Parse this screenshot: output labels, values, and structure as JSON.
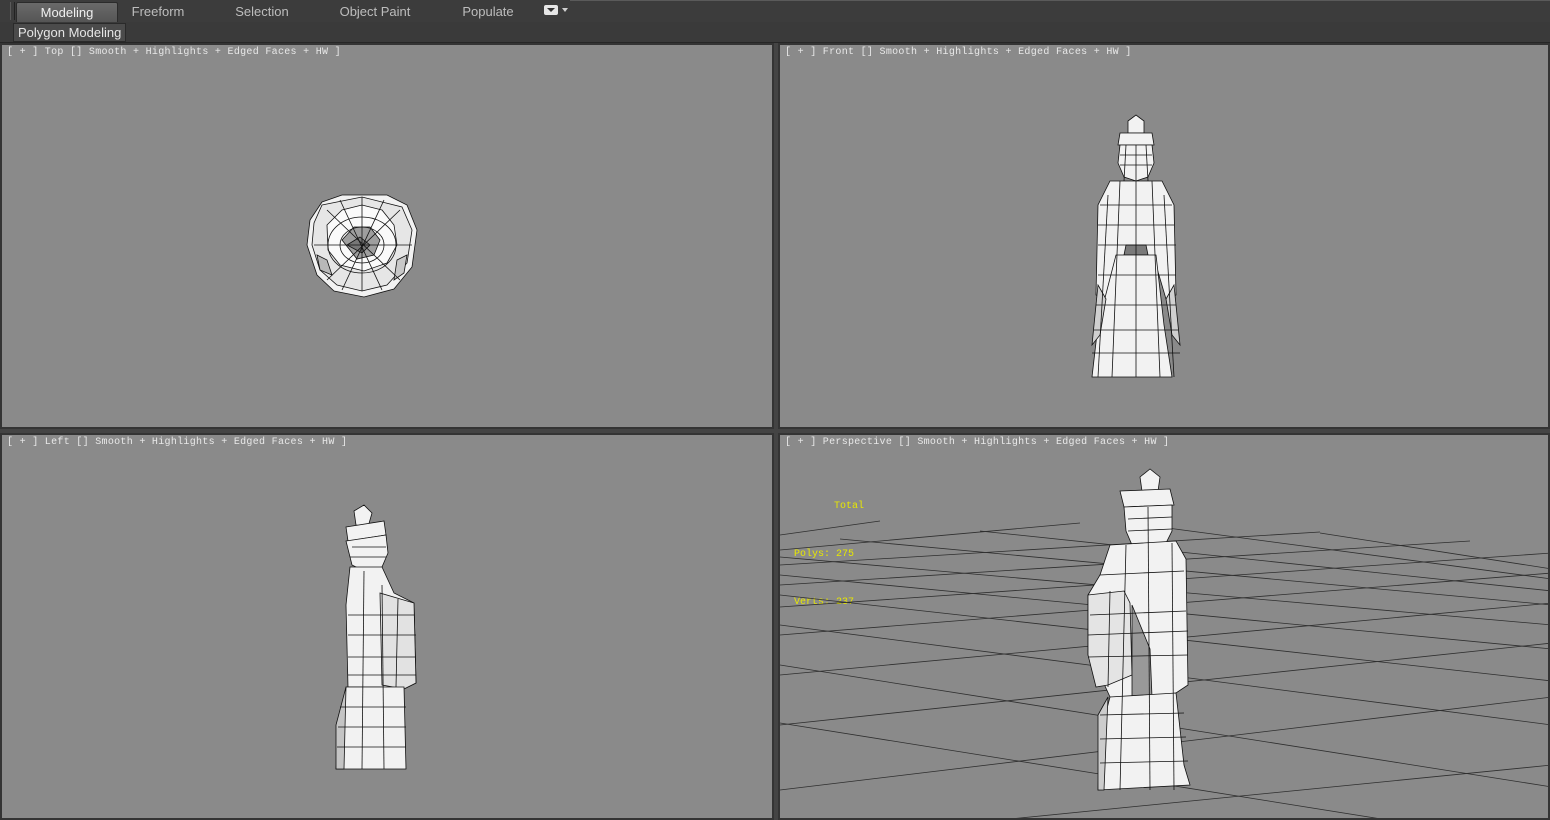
{
  "ribbon": {
    "tabs": [
      {
        "label": "Modeling",
        "active": true
      },
      {
        "label": "Freeform",
        "active": false
      },
      {
        "label": "Selection",
        "active": false
      },
      {
        "label": "Object Paint",
        "active": false
      },
      {
        "label": "Populate",
        "active": false
      }
    ],
    "overflow_icon": "dropdown-toggle-icon",
    "panel_label": "Polygon Modeling"
  },
  "viewports": {
    "top": {
      "label": "[ + ] Top [] Smooth + Highlights + Edged Faces + HW ]"
    },
    "front": {
      "label": "[ + ] Front [] Smooth + Highlights + Edged Faces + HW ]"
    },
    "left": {
      "label": "[ + ] Left [] Smooth + Highlights + Edged Faces + HW ]"
    },
    "perspective": {
      "label": "[ + ] Perspective [] Smooth + Highlights + Edged Faces + HW ]",
      "stats": {
        "header": "Total",
        "polys_label": "Polys:",
        "polys": "275",
        "verts_label": "Verts:",
        "verts": "237"
      }
    }
  },
  "colors": {
    "viewport_bg": "#8a8a8a",
    "stats_text": "#e8e800",
    "mesh_fill": "#f2f2f2",
    "mesh_edge": "#111111",
    "grid_line": "#2e2e2e"
  }
}
